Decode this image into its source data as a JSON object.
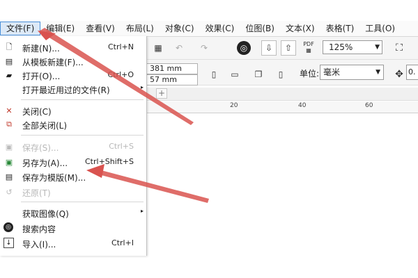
{
  "menubar": {
    "items": [
      "文件(F)",
      "编辑(E)",
      "查看(V)",
      "布局(L)",
      "对象(C)",
      "效果(C)",
      "位图(B)",
      "文本(X)",
      "表格(T)",
      "工具(O)"
    ]
  },
  "file_menu": {
    "items": [
      {
        "label": "新建(N)...",
        "shortcut": "Ctrl+N",
        "icon": "new-doc-icon",
        "enabled": true
      },
      {
        "label": "从模板新建(F)...",
        "shortcut": "",
        "icon": "template-new-icon",
        "enabled": true
      },
      {
        "label": "打开(O)...",
        "shortcut": "Ctrl+O",
        "icon": "folder-open-icon",
        "enabled": true
      },
      {
        "label": "打开最近用过的文件(R)",
        "shortcut": "",
        "icon": "",
        "enabled": true,
        "submenu": true
      },
      {
        "label": "关闭(C)",
        "shortcut": "",
        "icon": "close-doc-icon",
        "enabled": true
      },
      {
        "label": "全部关闭(L)",
        "shortcut": "",
        "icon": "close-all-icon",
        "enabled": true
      },
      {
        "label": "保存(S)...",
        "shortcut": "Ctrl+S",
        "icon": "save-icon",
        "enabled": false
      },
      {
        "label": "另存为(A)...",
        "shortcut": "Ctrl+Shift+S",
        "icon": "save-as-icon",
        "enabled": true
      },
      {
        "label": "保存为模版(M)...",
        "shortcut": "",
        "icon": "save-template-icon",
        "enabled": true
      },
      {
        "label": "还原(T)",
        "shortcut": "",
        "icon": "revert-icon",
        "enabled": false
      },
      {
        "label": "获取图像(Q)",
        "shortcut": "",
        "icon": "",
        "enabled": true,
        "submenu": true
      },
      {
        "label": "搜索内容",
        "shortcut": "",
        "icon": "search-content-icon",
        "enabled": true
      },
      {
        "label": "导入(I)...",
        "shortcut": "Ctrl+I",
        "icon": "import-icon",
        "enabled": true
      }
    ]
  },
  "toolbar": {
    "pdf_label": "PDF",
    "zoom_value": "125%",
    "width_value": "381 mm",
    "height_value": "57 mm",
    "unit_label": "单位:",
    "unit_value": "毫米",
    "nudge_value": "0."
  },
  "ruler": {
    "ticks": [
      "20",
      "40",
      "60"
    ]
  },
  "icons": {
    "submenu_arrow": "▸",
    "dropdown": "▼",
    "add_tab": "+"
  },
  "colors": {
    "annotation_arrow": "#d9534f",
    "menu_highlight": "#4a90d9"
  }
}
